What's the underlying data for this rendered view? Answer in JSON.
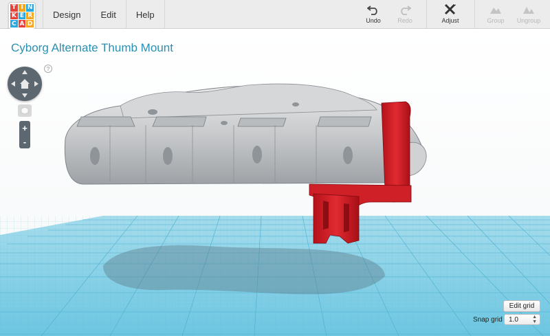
{
  "app": {
    "logo_letters": [
      "T",
      "I",
      "N",
      "K",
      "E",
      "R",
      "C",
      "A",
      "D"
    ],
    "logo_colors": [
      "#e8413c",
      "#f5a623",
      "#2aa8e0",
      "#e8413c",
      "#2aa8e0",
      "#f5a623",
      "#2aa8e0",
      "#e8413c",
      "#f5a623"
    ]
  },
  "menu": {
    "design": "Design",
    "edit": "Edit",
    "help": "Help"
  },
  "toolbar": {
    "undo": "Undo",
    "redo": "Redo",
    "adjust": "Adjust",
    "group": "Group",
    "ungroup": "Ungroup"
  },
  "design": {
    "title": "Cyborg Alternate Thumb Mount"
  },
  "controls": {
    "help": "?",
    "zoom_in": "+",
    "zoom_out": "-",
    "edit_grid": "Edit grid",
    "snap_grid_label": "Snap grid",
    "snap_grid_value": "1.0"
  },
  "colors": {
    "accent_title": "#2b8fb2",
    "workplane": "#7fcfe6",
    "grid_line": "#4fb3d4",
    "part_gray": "#c9cacc",
    "part_red": "#d21e26"
  }
}
